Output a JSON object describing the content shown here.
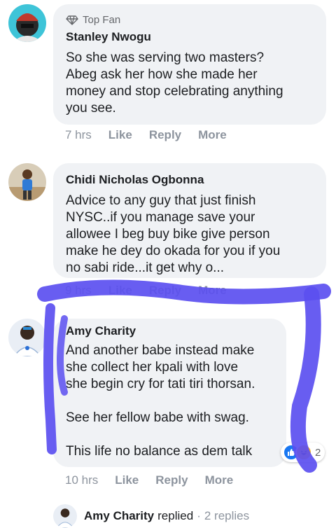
{
  "comments": [
    {
      "badge": "Top Fan",
      "author": "Stanley Nwogu",
      "lines": [
        "So she was serving two masters?",
        "Abeg ask her how she made her",
        "money and stop celebrating anything",
        "you see."
      ],
      "time": "7 hrs",
      "actions": [
        "Like",
        "Reply",
        "More"
      ]
    },
    {
      "author": "Chidi Nicholas Ogbonna",
      "lines": [
        "Advice to any guy that just finish",
        "NYSC..if you manage save your",
        "allowee I beg buy bike give person",
        "make he dey do okada for you if you",
        "no sabi ride...it get why o..."
      ],
      "time": "9 hrs",
      "actions": [
        "Like",
        "Reply",
        "More"
      ]
    },
    {
      "author": "Amy Charity",
      "lines": [
        "And another babe instead make",
        "she collect her kpali with love",
        "she begin cry for tati tiri thorsan.",
        "",
        "See her fellow babe with swag.",
        "",
        "This life no balance as dem talk"
      ],
      "time": "10 hrs",
      "actions": [
        "Like",
        "Reply",
        "More"
      ],
      "reaction_count": "2"
    }
  ],
  "reply_summary": {
    "author": "Amy Charity",
    "verb": "replied",
    "separator": "·",
    "count": "2 replies"
  },
  "colors": {
    "bubble": "#f0f2f5",
    "scribble": "#5b4ff0",
    "like_blue": "#1877f2",
    "haha_yellow": "#f7b125"
  },
  "icons": [
    "diamond-icon",
    "like-reaction-icon",
    "haha-reaction-icon"
  ]
}
